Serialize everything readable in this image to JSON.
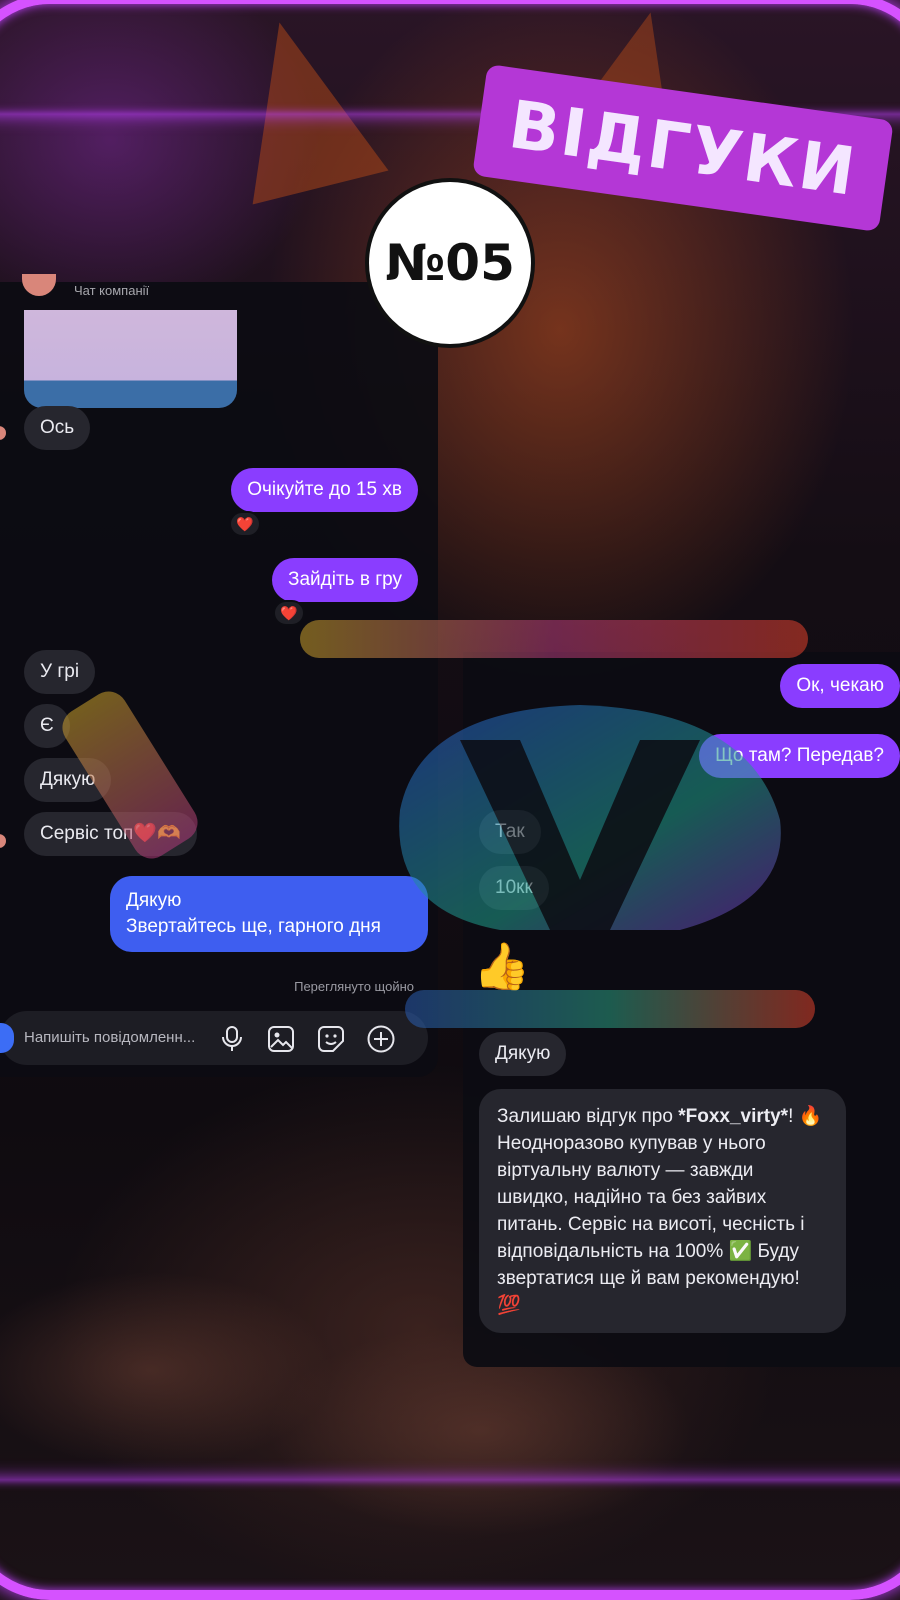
{
  "badge": {
    "title": "ВІДГУКИ",
    "number": "№05"
  },
  "left_chat": {
    "header_label": "Чат компанії",
    "messages": {
      "m1": "Ось",
      "m2": "Очікуйте до 15 хв",
      "m3": "Зайдіть в гру",
      "m4": "У грі",
      "m5": "Є",
      "m6": "Дякую",
      "m7": "Сервіс топ❤️🫶",
      "m8_line1": "Дякую",
      "m8_line2": "Звертайтесь ще, гарного дня"
    },
    "reaction": "❤️",
    "seen_status": "Переглянуто щойно",
    "composer": {
      "placeholder": "Напишіть повідомленн...",
      "icons": [
        "microphone-icon",
        "image-icon",
        "sticker-icon",
        "plus-icon"
      ]
    }
  },
  "right_chat": {
    "messages": {
      "m1": "Ок, чекаю",
      "m2": "Що там? Передав?",
      "m3": "Так",
      "m4": "10кк",
      "m5": "👍",
      "m6": "Дякую"
    },
    "review": {
      "part1": "Залишаю відгук про",
      "name": "*Foxx_virty*",
      "part2": "! 🔥 Неодноразово купував у нього віртуальну валюту — завжди швидко, надійно та без зайвих питань. Сервіс на висоті, чесність і відповідальність на 100% ✅ Буду звертатися ще й вам рекомендую! 💯"
    }
  },
  "colors": {
    "frame": "#d552ff",
    "badge": "#b437d6",
    "outgoing_purple": "#8a3dff",
    "outgoing_blue": "#3e5ef0",
    "incoming": "#26262e"
  }
}
